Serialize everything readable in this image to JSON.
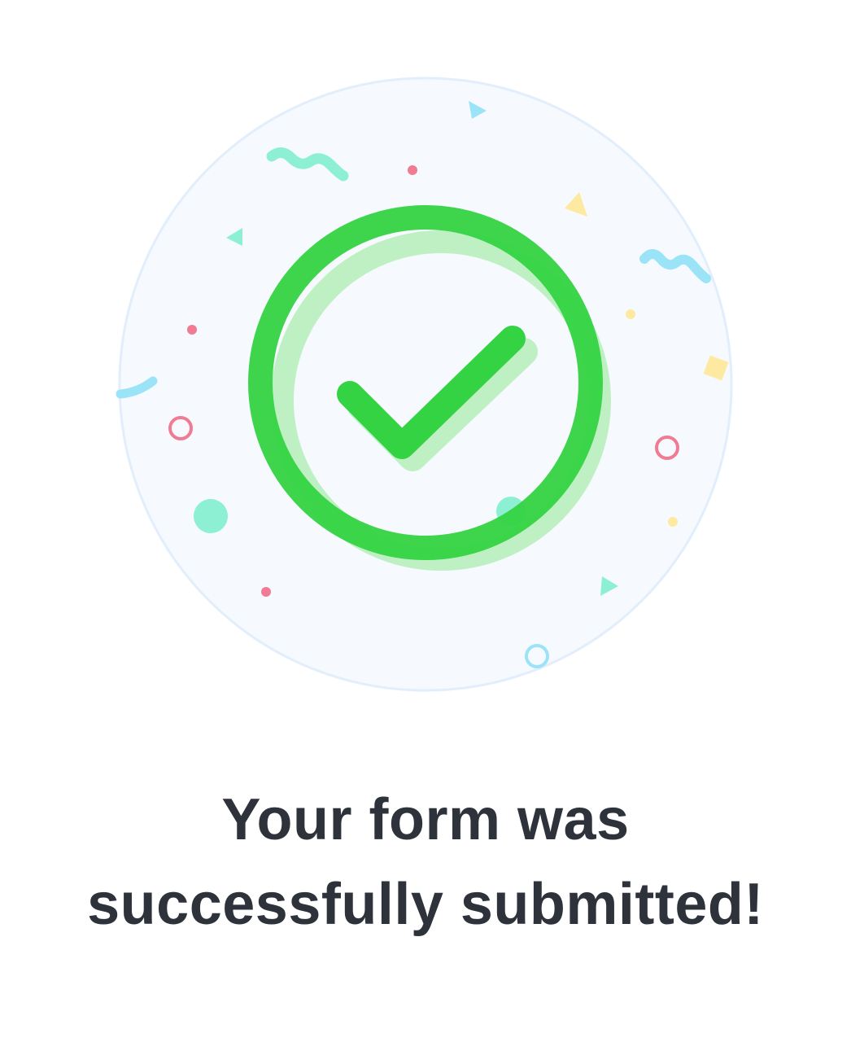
{
  "success": {
    "message_line_1": "Your form was",
    "message_line_2": "successfully submitted!",
    "icon": "check-circle-icon"
  },
  "colors": {
    "check_green": "#34d343",
    "check_green_light": "#bff0c3",
    "badge_background": "#f6fafe",
    "badge_border": "#e2eefb",
    "text": "#2e333b",
    "confetti_pink": "#f07b93",
    "confetti_teal": "#8ef0d2",
    "confetti_blue": "#9be3f7",
    "confetti_yellow": "#fde9a0"
  }
}
